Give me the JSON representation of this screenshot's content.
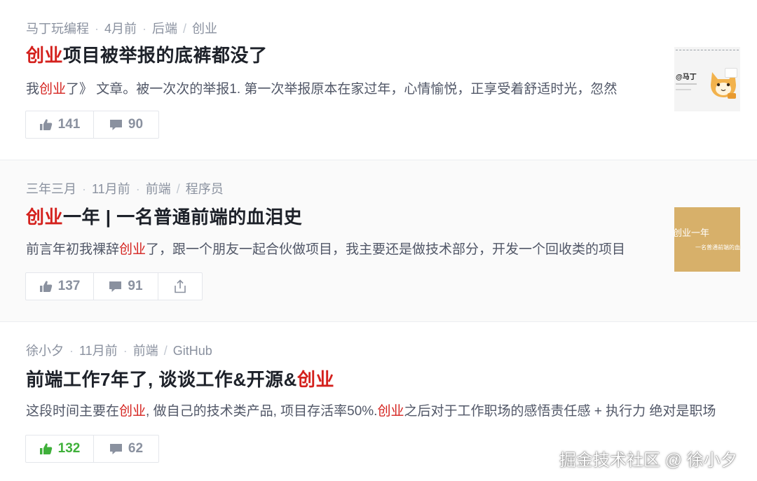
{
  "articles": [
    {
      "author": "马丁玩编程",
      "time": "4月前",
      "tags": [
        "后端",
        "创业"
      ],
      "title_hl": "创业",
      "title_rest": "项目被举报的底裤都没了",
      "abstract_pre": "我",
      "abstract_hl": "创业",
      "abstract_post": "了》 文章。被一次次的举报1. 第一次举报原本在家过年，心情愉悦，正享受着舒适时光，忽然",
      "likes": "141",
      "comments": "90",
      "thumb_text": "@马丁"
    },
    {
      "author": "三年三月",
      "time": "11月前",
      "tags": [
        "前端",
        "程序员"
      ],
      "title_hl": "创业",
      "title_rest": "一年 | 一名普通前端的血泪史",
      "abstract_pre": "前言年初我裸辞",
      "abstract_hl": "创业",
      "abstract_post": "了，跟一个朋友一起合伙做项目，我主要还是做技术部分，开发一个回收类的项目",
      "likes": "137",
      "comments": "91",
      "thumb_text": "创业一年",
      "thumb_sub": "一名普通前端的血泪史"
    },
    {
      "author": "徐小夕",
      "time": "11月前",
      "tags": [
        "前端",
        "GitHub"
      ],
      "title_pre": "前端工作7年了, 谈谈工作&开源&",
      "title_hl": "创业",
      "abstract_pre": "这段时间主要在",
      "abstract_hl": "创业",
      "abstract_mid": ", 做自己的技术类产品, 项目存活率50%.",
      "abstract_hl2": "创业",
      "abstract_post": "之后对于工作职场的感悟责任感 + 执行力 绝对是职场",
      "likes": "132",
      "comments": "62"
    }
  ],
  "watermark": "掘金技术社区 @ 徐小夕",
  "colors": {
    "highlight": "#d4211d",
    "liked": "#3fb03a",
    "muted": "#8a919f"
  },
  "icons": [
    "thumbs-up-icon",
    "comment-icon",
    "share-icon"
  ]
}
